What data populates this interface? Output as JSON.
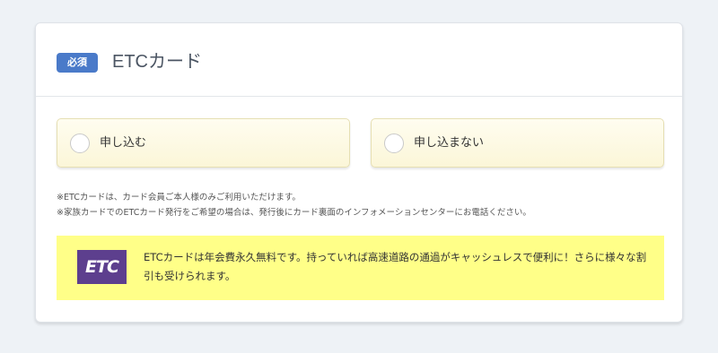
{
  "header": {
    "badge": "必須",
    "title": "ETCカード"
  },
  "options": [
    {
      "label": "申し込む",
      "selected": false
    },
    {
      "label": "申し込まない",
      "selected": false
    }
  ],
  "notes": [
    "※ETCカードは、カード会員ご本人様のみご利用いただけます。",
    "※家族カードでのETCカード発行をご希望の場合は、発行後にカード裏面のインフォメーションセンターにお電話ください。"
  ],
  "info": {
    "logo_text": "ETC",
    "text": "ETCカードは年会費永久無料です。持っていれば高速道路の通過がキャッシュレスで便利に！さらに様々な割引も受けられます。"
  },
  "colors": {
    "badge": "#4a7ac9",
    "logo": "#5d3f8e",
    "info_bg": "#ffff88",
    "option_bg": "#fdf9e2"
  }
}
